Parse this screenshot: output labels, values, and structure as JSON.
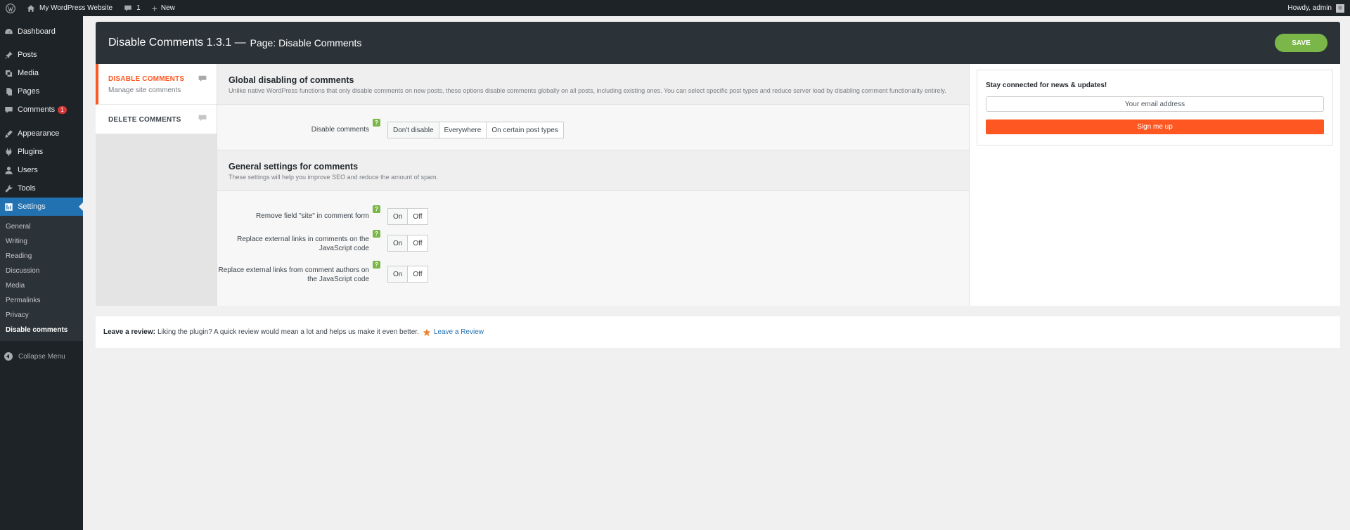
{
  "adminbar": {
    "site_name": "My WordPress Website",
    "comments_count": "1",
    "new_label": "New",
    "howdy": "Howdy, admin"
  },
  "sidebar": {
    "items": [
      {
        "label": "Dashboard",
        "icon": "dashboard-icon"
      },
      {
        "label": "Posts",
        "icon": "pin-icon"
      },
      {
        "label": "Media",
        "icon": "media-icon"
      },
      {
        "label": "Pages",
        "icon": "pages-icon"
      },
      {
        "label": "Comments",
        "icon": "comment-icon",
        "badge": "1"
      },
      {
        "label": "Appearance",
        "icon": "brush-icon"
      },
      {
        "label": "Plugins",
        "icon": "plug-icon"
      },
      {
        "label": "Users",
        "icon": "user-icon"
      },
      {
        "label": "Tools",
        "icon": "wrench-icon"
      },
      {
        "label": "Settings",
        "icon": "settings-icon"
      }
    ],
    "submenu": [
      "General",
      "Writing",
      "Reading",
      "Discussion",
      "Media",
      "Permalinks",
      "Privacy",
      "Disable comments"
    ],
    "collapse_label": "Collapse Menu"
  },
  "plugin": {
    "title": "Disable Comments 1.3.1 —",
    "subtitle": "Page: Disable Comments",
    "save_label": "SAVE",
    "tabs": [
      {
        "label": "DISABLE COMMENTS",
        "sublabel": "Manage site comments"
      },
      {
        "label": "DELETE COMMENTS",
        "sublabel": ""
      }
    ],
    "global": {
      "title": "Global disabling of comments",
      "description": "Unlike native WordPress functions that only disable comments on new posts, these options disable comments globally on all posts, including existing ones. You can select specific post types and reduce server load by disabling comment functionality entirely.",
      "disable_label": "Disable comments",
      "options": [
        "Don't disable",
        "Everywhere",
        "On certain post types"
      ],
      "selected": "Don't disable"
    },
    "general": {
      "title": "General settings for comments",
      "description": "These settings will help you improve SEO and reduce the amount of spam.",
      "settings": [
        {
          "label": "Remove field \"site\" in comment form"
        },
        {
          "label": "Replace external links in comments on the JavaScript code"
        },
        {
          "label": "Replace external links from comment authors on the JavaScript code"
        }
      ],
      "on_label": "On",
      "off_label": "Off",
      "help": "?"
    },
    "newsletter": {
      "title": "Stay connected for news & updates!",
      "email_placeholder": "Your email address",
      "button": "Sign me up"
    }
  },
  "review": {
    "bold": "Leave a review:",
    "text": "Liking the plugin? A quick review would mean a lot and helps us make it even better.",
    "link": "Leave a Review"
  },
  "colors": {
    "accent": "#ff5722",
    "save": "#7ab648",
    "wp_blue": "#2271b1"
  }
}
